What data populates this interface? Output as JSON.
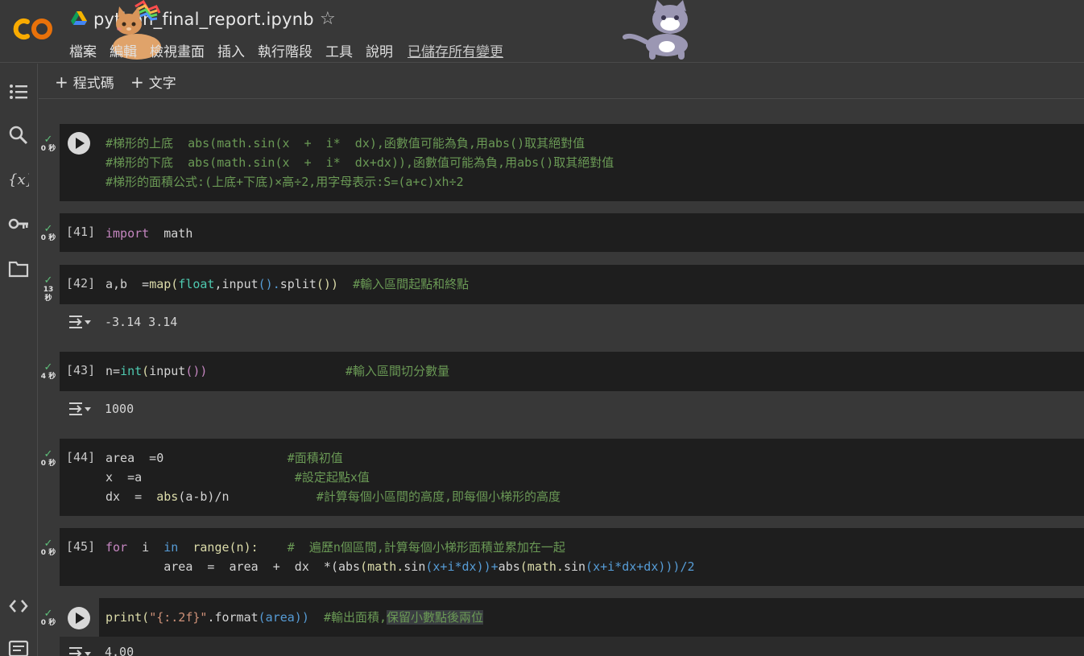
{
  "header": {
    "title": "python_final_report.ipynb",
    "menu": [
      "檔案",
      "編輯",
      "檢視畫面",
      "插入",
      "執行階段",
      "工具",
      "說明"
    ],
    "saved_status": "已儲存所有變更"
  },
  "toolbar": {
    "add_code": "程式碼",
    "add_text": "文字"
  },
  "cells": [
    {
      "status": "0 秒",
      "lines": [
        "#梯形的上底  abs(math.sin(x  +  i*  dx),函數值可能為負,用abs()取其絕對值",
        "#梯形的下底  abs(math.sin(x  +  i*  dx+dx)),函數值可能為負,用abs()取其絕對值",
        "#梯形的面積公式:(上底+下底)×高÷2,用字母表示:S=(a+c)xh÷2"
      ]
    },
    {
      "status": "0 秒",
      "exec": "[41]",
      "kw": "import",
      "rest": "  math"
    },
    {
      "status_top": "13",
      "status_bottom": "秒",
      "exec": "[42]",
      "code_a": "a,b  =",
      "code_fn": "map",
      "code_b": "(",
      "code_bi": "float",
      "code_c": ",",
      "code_fn2": "input",
      "code_d": "().",
      "code_fn3": "split",
      "code_e": "())  ",
      "comment": "#輸入區間起點和終點",
      "output": "-3.14 3.14"
    },
    {
      "status": "4 秒",
      "exec": "[43]",
      "code_a": "n=",
      "code_bi": "int",
      "code_b": "(",
      "code_fn": "input",
      "code_c": "())                   ",
      "comment": "#輸入區間切分數量",
      "output": "1000"
    },
    {
      "status": "0 秒",
      "exec": "[44]",
      "line1_code": "area  =0                 ",
      "line1_comment": "#面積初值",
      "line2_code": "x  =a                     ",
      "line2_comment": "#設定起點x值",
      "line3_a": "dx  =  ",
      "line3_fn": "abs",
      "line3_b": "(a-b)/n            ",
      "line3_comment": "#計算每個小區間的高度,即每個小梯形的高度"
    },
    {
      "status": "0 秒",
      "exec": "[45]",
      "l1_kw": "for",
      "l1_a": "  i  ",
      "l1_in": "in",
      "l1_b": "  ",
      "l1_fn": "range",
      "l1_c": "(n):    ",
      "l1_comment": "#  遍歷n個區間,計算每個小梯形面積並累加在一起",
      "l2_indent": "        area  =  area  +  dx  *(",
      "l2_fn1": "abs",
      "l2_a": "(math.",
      "l2_fn2": "sin",
      "l2_b": "(x+i*dx))+",
      "l2_fn3": "abs",
      "l2_c": "(math.",
      "l2_fn4": "sin",
      "l2_d": "(x+i*dx+dx)))/2"
    },
    {
      "status": "0 秒",
      "fn": "print",
      "a": "(",
      "str": "\"{:.2f}\"",
      "b": ".",
      "fn2": "format",
      "c": "(area))  ",
      "comment_a": "#輸出面積,",
      "comment_b": "保留小數點後兩位",
      "output": "4.00"
    }
  ]
}
